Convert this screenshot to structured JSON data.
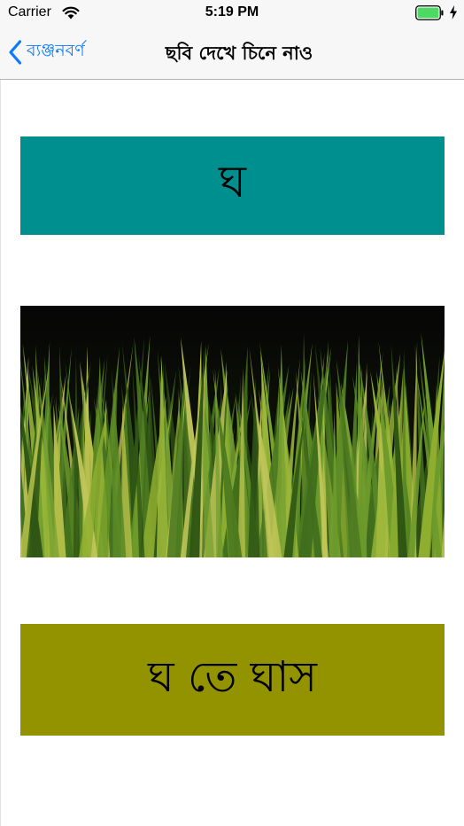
{
  "status_bar": {
    "carrier": "Carrier",
    "time": "5:19 PM",
    "battery_color": "#4cd964"
  },
  "nav": {
    "back_label": "ব্যঞ্জনবর্ণ",
    "title": "ছবি দেখে চিনে নাও",
    "tint_color": "#0a7aff"
  },
  "card": {
    "letter": "ঘ",
    "letter_bg": "#008f8f",
    "image_subject": "grass",
    "word": "ঘ তে ঘাস",
    "word_bg": "#939300"
  }
}
